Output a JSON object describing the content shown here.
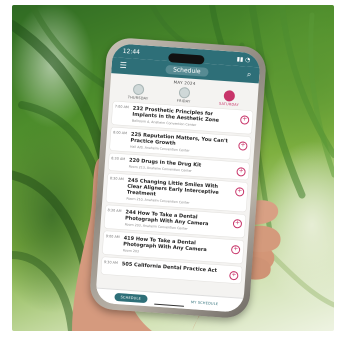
{
  "app": {
    "status_time": "12:44",
    "status_icons": "▮▮ ◔",
    "title": "Schedule",
    "menu_icon": "hamburger-icon",
    "search_icon": "search-icon"
  },
  "calendar": {
    "month_label": "MAY 2024",
    "days": [
      {
        "label": "THURSDAY",
        "active": false
      },
      {
        "label": "FRIDAY",
        "active": false
      },
      {
        "label": "SATURDAY",
        "active": true
      }
    ]
  },
  "sessions": [
    {
      "time": "7:00 AM",
      "title": "232 Prosthetic Principles for Implants in the Aesthetic Zone",
      "location": "Ballroom A, Anaheim Convention Center"
    },
    {
      "time": "8:00 AM",
      "title": "225 Reputation Matters, You Can't Practice Growth",
      "location": "Hall A/B, Anaheim Convention Center"
    },
    {
      "time": "8:30 AM",
      "title": "220 Drugs in the Drug Kit",
      "location": "Room 213, Anaheim Convention Center"
    },
    {
      "time": "8:30 AM",
      "title": "245 Changing Little Smiles With Clear Aligners Early Interceptive Treatment",
      "location": "Room 210, Anaheim Convention Center"
    },
    {
      "time": "8:30 AM",
      "title": "244 How To Take a Dental Photograph With Any Camera",
      "location": "Room 203, Anaheim Convention Center"
    },
    {
      "time": "9:00 AM",
      "title": "419 How To Take a Dental Photograph With Any Camera",
      "location": "Room 203"
    },
    {
      "time": "9:30 AM",
      "title": "505 California Dental Practice Act",
      "location": ""
    }
  ],
  "bottom_nav": {
    "schedule_label": "SCHEDULE",
    "my_schedule_label": "MY SCHEDULE"
  },
  "colors": {
    "brand": "#2e6f78",
    "accent": "#c8356a"
  }
}
